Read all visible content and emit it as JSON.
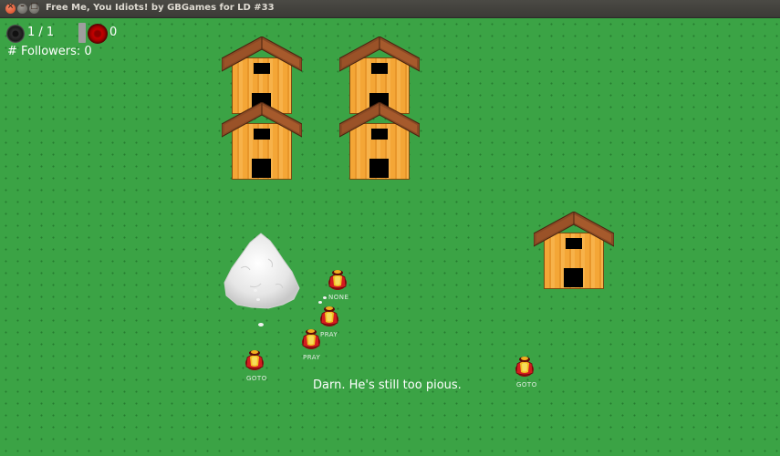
{
  "window": {
    "title": "Free Me, You Idiots! by GBGames for LD #33"
  },
  "hud": {
    "orb_count": "1 / 1",
    "red_count": "0",
    "followers": "# Followers: 0"
  },
  "houses": [
    {
      "id": "house-1"
    },
    {
      "id": "house-2"
    },
    {
      "id": "house-3"
    },
    {
      "id": "house-4"
    },
    {
      "id": "house-5"
    }
  ],
  "villagers": [
    {
      "label": "NONE"
    },
    {
      "label": "PRAY"
    },
    {
      "label": "PRAY"
    },
    {
      "label": "GOTO"
    },
    {
      "label": "GOTO"
    }
  ],
  "message": "Darn. He's still too pious.",
  "colors": {
    "grass": "#3ba345",
    "house_wall": "#f4a636",
    "roof": "#8b4a24",
    "villager_robe": "#c0151a"
  },
  "icons": [
    "dark-orb-icon",
    "red-orb-icon",
    "rock-icon",
    "house-icon",
    "villager-icon"
  ]
}
